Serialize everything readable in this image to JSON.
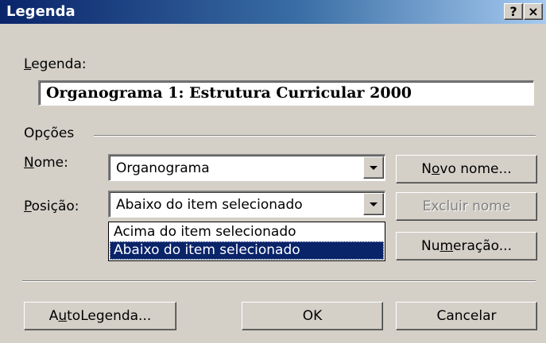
{
  "window": {
    "title": "Legenda",
    "help_button": "?",
    "close_button": "×"
  },
  "caption": {
    "label_hotkey": "L",
    "label_rest": "egenda:",
    "value": "Organograma 1: Estrutura Curricular 2000"
  },
  "options": {
    "group_label": "Opções",
    "name": {
      "label_hotkey": "N",
      "label_rest": "ome:",
      "value": "Organograma"
    },
    "position": {
      "label_hotkey": "P",
      "label_rest": "osição:",
      "value": "Abaixo do item selecionado",
      "dropdown_items": [
        "Acima do item selecionado",
        "Abaixo do item selecionado"
      ],
      "selected_index": 1
    }
  },
  "buttons": {
    "new_name": {
      "before": "N",
      "hotkey": "o",
      "after": "vo nome..."
    },
    "delete_name": "Excluir nome",
    "numbering": {
      "before": "Nu",
      "hotkey": "m",
      "after": "eração..."
    },
    "autocaption": {
      "before": "A",
      "hotkey": "u",
      "after": "toLegenda..."
    },
    "ok": "OK",
    "cancel": "Cancelar"
  },
  "colors": {
    "dialog_bg": "#d4d0c8",
    "title_gradient_start": "#0a246a",
    "title_gradient_end": "#a6caf0",
    "selection_bg": "#0a246a"
  }
}
